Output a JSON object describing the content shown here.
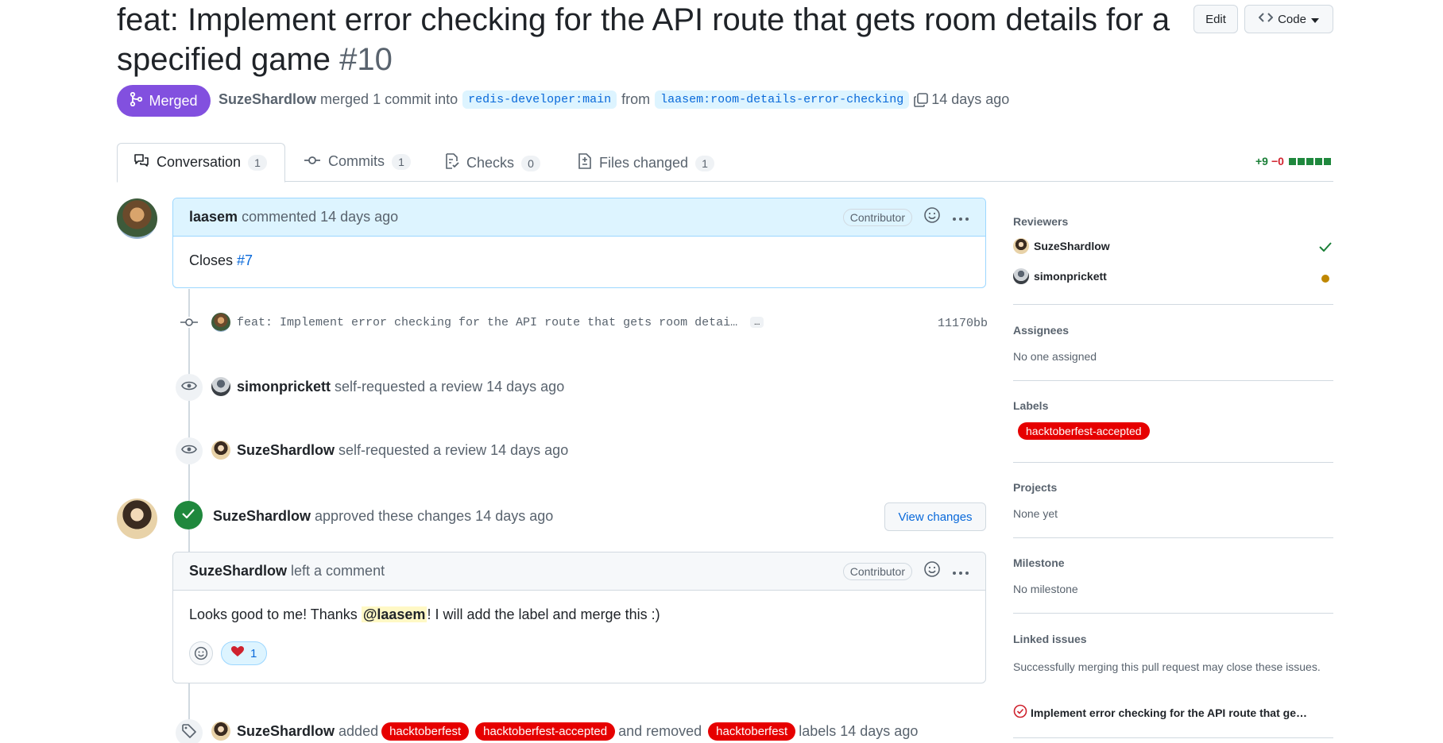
{
  "pr": {
    "title": "feat: Implement error checking for the API route that gets room details for a specified game",
    "number": "#10",
    "edit_label": "Edit",
    "code_label": "Code",
    "state_label": "Merged",
    "author": "SuzeShardlow",
    "merge_text": "merged 1 commit into",
    "base_branch": "redis-developer:main",
    "from_text": "from",
    "head_branch": "laasem:room-details-error-checking",
    "time": "14 days ago"
  },
  "tabs": [
    {
      "label": "Conversation",
      "count": "1",
      "active": true
    },
    {
      "label": "Commits",
      "count": "1"
    },
    {
      "label": "Checks",
      "count": "0"
    },
    {
      "label": "Files changed",
      "count": "1"
    }
  ],
  "diffstat": {
    "additions": "+9",
    "deletions": "−0",
    "blocks": 5
  },
  "timeline": {
    "opening_comment": {
      "author": "laasem",
      "action": "commented 14 days ago",
      "role": "Contributor",
      "body_prefix": "Closes",
      "issue_link": "#7"
    },
    "commit": {
      "message": "feat: Implement error checking for the API route that gets room detai…",
      "ellipsis": "…",
      "sha": "11170bb"
    },
    "review_request_1": {
      "author": "simonprickett",
      "text": "self-requested a review 14 days ago"
    },
    "review_request_2": {
      "author": "SuzeShardlow",
      "text": "self-requested a review 14 days ago"
    },
    "approval": {
      "author": "SuzeShardlow",
      "text": "approved these changes 14 days ago",
      "view_changes": "View changes"
    },
    "review_comment": {
      "author": "SuzeShardlow",
      "action": "left a comment",
      "role": "Contributor",
      "body_before": "Looks good to me! Thanks",
      "mention": "@laasem",
      "body_after": "! I will add the label and merge this :)",
      "heart_count": "1"
    },
    "label_event": {
      "author": "SuzeShardlow",
      "added_text": "added",
      "added_labels": [
        "hacktoberfest",
        "hacktoberfest-accepted"
      ],
      "removed_text": "and removed",
      "removed_label": "hacktoberfest",
      "suffix": "labels 14 days ago"
    }
  },
  "sidebar": {
    "reviewers_heading": "Reviewers",
    "reviewers": [
      {
        "name": "SuzeShardlow",
        "status": "approved"
      },
      {
        "name": "simonprickett",
        "status": "pending"
      }
    ],
    "assignees_heading": "Assignees",
    "assignees_text": "No one assigned",
    "labels_heading": "Labels",
    "label": "hacktoberfest-accepted",
    "projects_heading": "Projects",
    "projects_text": "None yet",
    "milestone_heading": "Milestone",
    "milestone_text": "No milestone",
    "linked_heading": "Linked issues",
    "linked_text": "Successfully merging this pull request may close these issues.",
    "linked_issue": "Implement error checking for the API route that ge…"
  },
  "colors": {
    "merged": "#8250df",
    "label_red": "#e60000",
    "link_blue": "#0969da",
    "success_green": "#1f883d",
    "pending_yellow": "#bf8700"
  }
}
